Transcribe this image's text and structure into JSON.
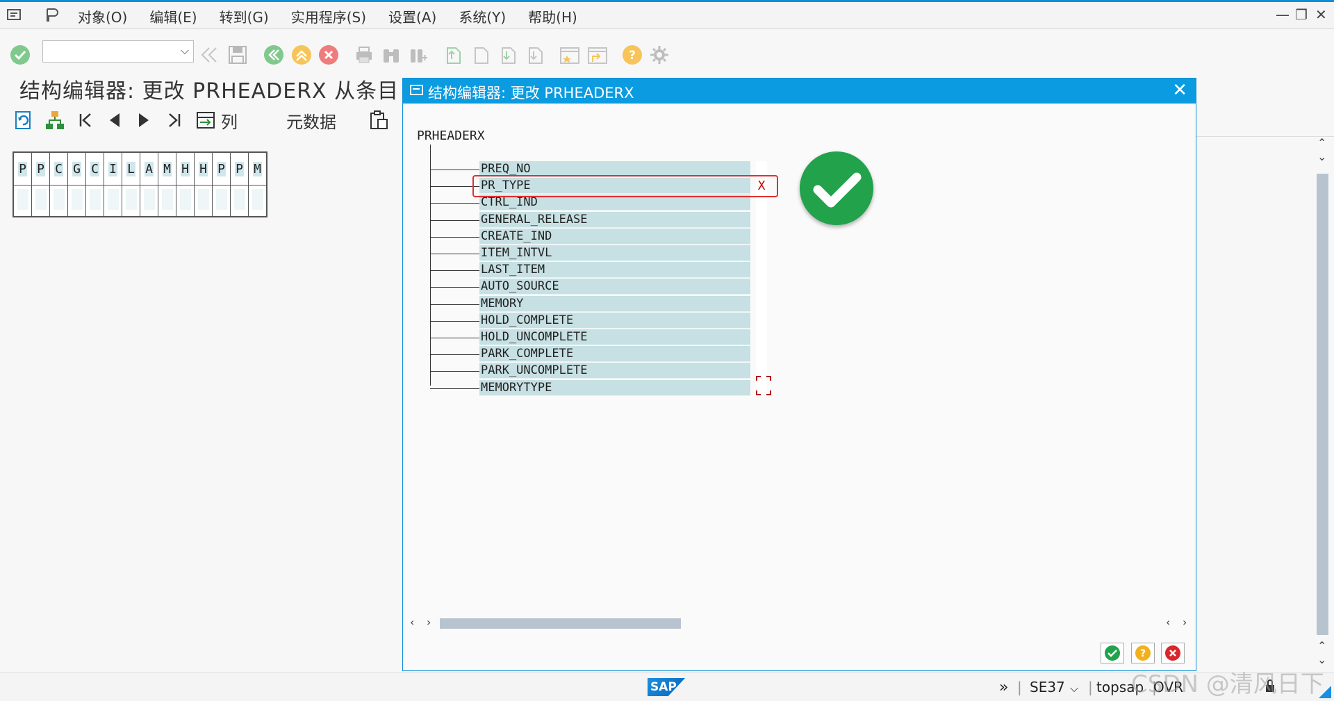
{
  "menu": {
    "items": [
      "对象(O)",
      "编辑(E)",
      "转到(G)",
      "实用程序(S)",
      "设置(A)",
      "系统(Y)",
      "帮助(H)"
    ]
  },
  "toolbar": {
    "command_value": ""
  },
  "page": {
    "title": "结构编辑器: 更改 PRHEADERX 从条目"
  },
  "app_toolbar": {
    "columns_label": "列",
    "metadata_label": "元数据"
  },
  "grid": {
    "headers": [
      "P",
      "P",
      "C",
      "G",
      "C",
      "I",
      "L",
      "A",
      "M",
      "H",
      "H",
      "P",
      "P",
      "M"
    ]
  },
  "dialog": {
    "title": "结构编辑器: 更改 PRHEADERX",
    "root": "PRHEADERX",
    "fields": [
      {
        "name": "PREQ_NO",
        "value": ""
      },
      {
        "name": "PR_TYPE",
        "value": "X"
      },
      {
        "name": "CTRL_IND",
        "value": ""
      },
      {
        "name": "GENERAL_RELEASE",
        "value": ""
      },
      {
        "name": "CREATE_IND",
        "value": ""
      },
      {
        "name": "ITEM_INTVL",
        "value": ""
      },
      {
        "name": "LAST_ITEM",
        "value": ""
      },
      {
        "name": "AUTO_SOURCE",
        "value": ""
      },
      {
        "name": "MEMORY",
        "value": ""
      },
      {
        "name": "HOLD_COMPLETE",
        "value": ""
      },
      {
        "name": "HOLD_UNCOMPLETE",
        "value": ""
      },
      {
        "name": "PARK_COMPLETE",
        "value": ""
      },
      {
        "name": "PARK_UNCOMPLETE",
        "value": ""
      },
      {
        "name": "MEMORYTYPE",
        "value": ""
      }
    ]
  },
  "status": {
    "transaction": "SE37",
    "system": "topsap",
    "mode": "OVR",
    "logo": "SAP"
  },
  "watermark": "CSDN @清风日下",
  "colors": {
    "accent": "#0a9be0",
    "field_bg": "#c7e0e3",
    "highlight": "#e03030",
    "ok": "#22a24a"
  }
}
